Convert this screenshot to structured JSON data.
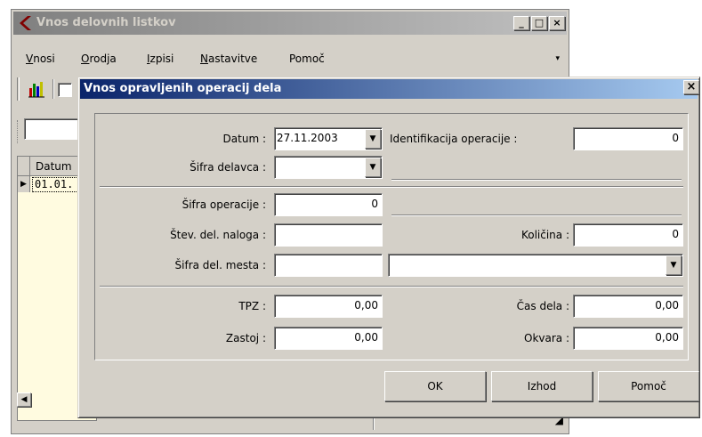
{
  "back_window": {
    "title": "Vnos delovnih listkov",
    "caption": {
      "minimize": "_",
      "maximize": "□",
      "close": "×"
    },
    "menu": [
      {
        "mnemonic": "V",
        "rest": "nosi"
      },
      {
        "mnemonic": "O",
        "rest": "rodja"
      },
      {
        "mnemonic": "I",
        "rest": "zpisi"
      },
      {
        "mnemonic": "N",
        "rest": "astavitve"
      },
      {
        "mnemonic": "",
        "rest": "Pomoč"
      }
    ],
    "menu_arrow": "▾",
    "grid": {
      "column_header": "Datum",
      "row_indicator": "▶",
      "cell_value": "01.01."
    },
    "hscroll_left": "◀",
    "status_grip": "◢"
  },
  "dialog": {
    "title": "Vnos opravljenih operacij dela",
    "close": "×",
    "datum": {
      "label": "Datum :",
      "value": "27.11.2003"
    },
    "sifra_delavca": {
      "label": "Šifra delavca :",
      "value": ""
    },
    "identifikacija": {
      "label": "Identifikacija operacije :",
      "value": "0"
    },
    "sifra_operacije": {
      "label": "Šifra operacije :",
      "value": "0"
    },
    "stev_del_naloga": {
      "label": "Štev. del. naloga :",
      "value": ""
    },
    "kolicina": {
      "label": "Količina :",
      "value": "0"
    },
    "sifra_del_mesta": {
      "label": "Šifra del. mesta :",
      "value": ""
    },
    "del_mesta_combo": {
      "value": ""
    },
    "tpz": {
      "label": "TPZ :",
      "value": "0,00"
    },
    "cas_dela": {
      "label": "Čas dela :",
      "value": "0,00"
    },
    "zastoj": {
      "label": "Zastoj :",
      "value": "0,00"
    },
    "okvara": {
      "label": "Okvara :",
      "value": "0,00"
    },
    "combo_arrow": "▼",
    "buttons": {
      "ok": "OK",
      "izhod": "Izhod",
      "pomoc": "Pomoč"
    }
  }
}
